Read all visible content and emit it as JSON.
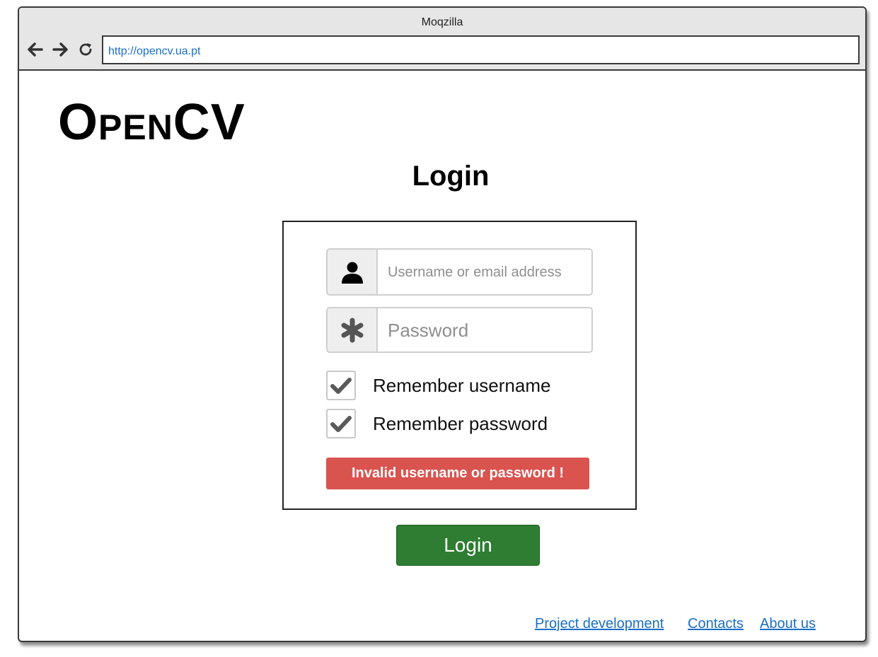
{
  "browser": {
    "title": "Moqzilla",
    "url": "http://opencv.ua.pt",
    "icons": [
      "back-arrow-icon",
      "forward-arrow-icon",
      "reload-icon"
    ]
  },
  "page": {
    "logo": "OpenCV",
    "heading": "Login"
  },
  "form": {
    "username_placeholder": "Username or email address",
    "password_placeholder": "Password",
    "remember_username": {
      "label": "Remember username",
      "checked": true
    },
    "remember_password": {
      "label": "Remember password",
      "checked": true
    },
    "error_message": "Invalid username or password !",
    "submit_label": "Login"
  },
  "footer": {
    "links": [
      "Project development",
      "Contacts",
      "About us"
    ]
  },
  "colors": {
    "error": "#d9534f",
    "submit": "#2e7d32",
    "link": "#1a6fc8"
  }
}
